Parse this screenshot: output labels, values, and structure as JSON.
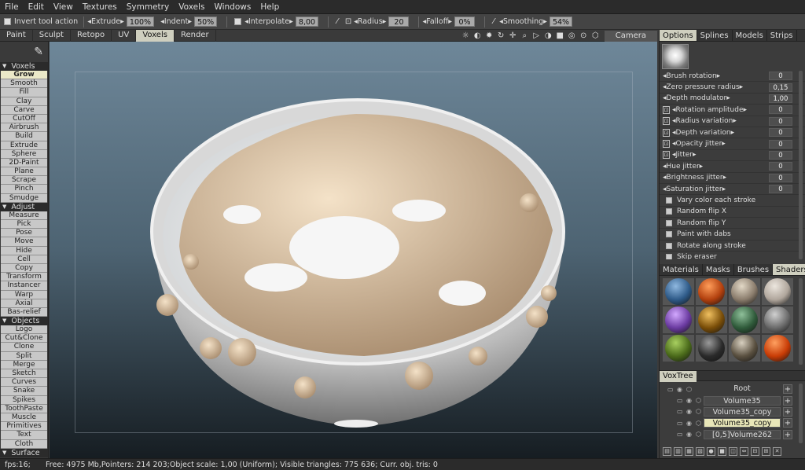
{
  "menu": [
    "File",
    "Edit",
    "View",
    "Textures",
    "Symmetry",
    "Voxels",
    "Windows",
    "Help"
  ],
  "toolbar": {
    "invert_label": "Invert tool action",
    "extrude_label": "◂Extrude▸",
    "extrude_value": "100%",
    "indent_label": "◂Indent▸",
    "indent_value": "50%",
    "interpolate_label": "◂Interpolate▸",
    "interpolate_value": "8,00",
    "radius_label": "◂Radius▸",
    "radius_value": "20",
    "falloff_label": "◂Falloff▸",
    "falloff_value": "0%",
    "smoothing_label": "◂Smoothing▸",
    "smoothing_value": "54%"
  },
  "tabs": {
    "items": [
      "Paint",
      "Sculpt",
      "Retopo",
      "UV",
      "Voxels",
      "Render"
    ],
    "active": "Voxels",
    "camera_label": "Camera"
  },
  "left": {
    "sections": [
      {
        "title": "Voxels",
        "tools": [
          "Grow",
          "Smooth",
          "Fill",
          "Clay",
          "Carve",
          "CutOff",
          "Airbrush",
          "Build",
          "Extrude",
          "Sphere",
          "2D-Paint",
          "Plane",
          "Scrape",
          "Pinch",
          "Smudge"
        ]
      },
      {
        "title": "Adjust",
        "tools": [
          "Measure",
          "Pick",
          "Pose",
          "Move",
          "Hide",
          "Cell",
          "Copy",
          "Transform",
          "Instancer",
          "Warp",
          "Axial",
          "Bas-relief"
        ]
      },
      {
        "title": "Objects",
        "tools": [
          "Logo",
          "Cut&Clone",
          "Clone",
          "Split",
          "Merge",
          "Sketch",
          "Curves",
          "Snake",
          "Spikes",
          "ToothPaste",
          "Muscle",
          "Primitives",
          "Text",
          "Cloth"
        ]
      },
      {
        "title": "Surface",
        "tools": []
      }
    ],
    "active_tool": "Grow"
  },
  "right": {
    "tabs": [
      "Options",
      "Splines",
      "Models",
      "Strips"
    ],
    "active_tab": "Options",
    "options": [
      {
        "label": "◂Brush rotation▸",
        "value": "0",
        "lock": false
      },
      {
        "label": "◂Zero pressure radius▸",
        "value": "0,15",
        "lock": false
      },
      {
        "label": "◂Depth modulator▸",
        "value": "1,00",
        "lock": false
      },
      {
        "label": "◂Rotation amplitude▸",
        "value": "0",
        "lock": true
      },
      {
        "label": "◂Radius variation▸",
        "value": "0",
        "lock": true
      },
      {
        "label": "◂Depth variation▸",
        "value": "0",
        "lock": true
      },
      {
        "label": "◂Opacity jitter▸",
        "value": "0",
        "lock": true
      },
      {
        "label": "◂Jitter▸",
        "value": "0",
        "lock": true
      },
      {
        "label": "◂Hue jitter▸",
        "value": "0",
        "lock": false
      },
      {
        "label": "◂Brightness jitter▸",
        "value": "0",
        "lock": false
      },
      {
        "label": "◂Saturation jitter▸",
        "value": "0",
        "lock": false
      }
    ],
    "checks": [
      "Vary color each stroke",
      "Random flip X",
      "Random flip Y",
      "Paint with dabs",
      "Rotate along stroke",
      "Skip eraser"
    ],
    "mat_tabs": [
      "Materials",
      "Masks",
      "Brushes",
      "Shaders"
    ],
    "active_mat_tab": "Shaders",
    "shaders": [
      {
        "color": "#2e5a88",
        "hi": "#8fb8e0"
      },
      {
        "color": "#b2400e",
        "hi": "#ff9d5a"
      },
      {
        "color": "#8a7c6c",
        "hi": "#e2d8c6"
      },
      {
        "color": "#b0a69c",
        "hi": "#ece6de"
      },
      {
        "color": "#6a3aa0",
        "hi": "#d2a8ff"
      },
      {
        "color": "#7a4e08",
        "hi": "#f0c060"
      },
      {
        "color": "#2f5a3a",
        "hi": "#8fc09a"
      },
      {
        "color": "#6a6a6a",
        "hi": "#d0d0d0"
      },
      {
        "color": "#4a6a1a",
        "hi": "#a8d060"
      },
      {
        "color": "#2a2a2a",
        "hi": "#9a9a9a"
      },
      {
        "color": "#5a5040",
        "hi": "#d8d0c0"
      },
      {
        "color": "#c83c06",
        "hi": "#ffa060"
      }
    ],
    "voxtree_title": "VoxTree",
    "voxtree": [
      {
        "name": "Root",
        "selected": false,
        "root": true
      },
      {
        "name": "Volume35",
        "selected": false,
        "root": false
      },
      {
        "name": "Volume35_copy",
        "selected": false,
        "root": false
      },
      {
        "name": "Volume35_copy",
        "selected": true,
        "root": false
      },
      {
        "name": "[0,5]Volume262",
        "selected": false,
        "root": false
      }
    ]
  },
  "status": {
    "fps": "fps:16;",
    "info": "Free: 4975 Mb,Pointers: 214 203;Object scale: 1,00 (Uniform); Visible triangles: 775 636; Curr. obj. tris: 0"
  },
  "colors": {
    "accent": "#cfcfbf",
    "sculpt": "#e6d2b8",
    "bowl": "#dcdcdc"
  }
}
